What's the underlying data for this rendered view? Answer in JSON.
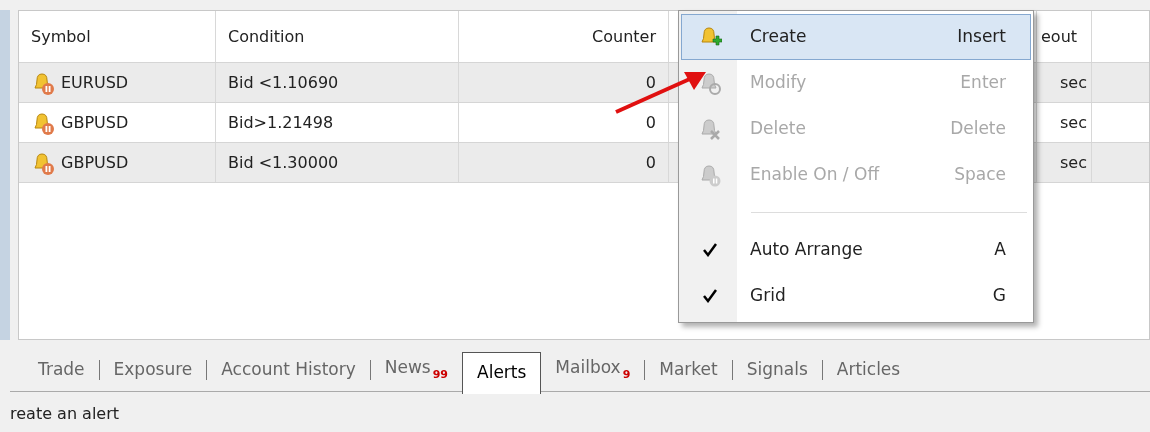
{
  "table": {
    "columns": [
      "Symbol",
      "Condition",
      "Counter",
      "",
      "eout"
    ],
    "rows": [
      {
        "symbol": "EURUSD",
        "condition": "Bid <1.10690",
        "counter": "0",
        "column_5": "sec"
      },
      {
        "symbol": "GBPUSD",
        "condition": "Bid>1.21498",
        "counter": "0",
        "column_5": "sec"
      },
      {
        "symbol": "GBPUSD",
        "condition": "Bid <1.30000",
        "counter": "0",
        "column_5": "sec"
      }
    ]
  },
  "context_menu": {
    "items": [
      {
        "kind": "command",
        "label": "Create",
        "shortcut": "Insert",
        "disabled": false,
        "selected": true
      },
      {
        "kind": "command",
        "label": "Modify",
        "shortcut": "Enter",
        "disabled": true,
        "selected": false
      },
      {
        "kind": "command",
        "label": "Delete",
        "shortcut": "Delete",
        "disabled": true,
        "selected": false
      },
      {
        "kind": "command",
        "label": "Enable On / Off",
        "shortcut": "Space",
        "disabled": true,
        "selected": false
      },
      {
        "kind": "separator"
      },
      {
        "kind": "check",
        "label": "Auto Arrange",
        "shortcut": "A",
        "checked": true,
        "selected": false
      },
      {
        "kind": "check",
        "label": "Grid",
        "shortcut": "G",
        "checked": true,
        "selected": false
      }
    ]
  },
  "tabs": [
    {
      "label": "Trade",
      "selected": false
    },
    {
      "label": "Exposure",
      "selected": false
    },
    {
      "label": "Account History",
      "selected": false
    },
    {
      "label": "News",
      "badge": "99",
      "selected": false
    },
    {
      "label": "Alerts",
      "selected": true
    },
    {
      "label": "Mailbox",
      "badge": "9",
      "selected": false
    },
    {
      "label": "Market",
      "selected": false
    },
    {
      "label": "Signals",
      "selected": false
    },
    {
      "label": "Articles",
      "selected": false
    }
  ],
  "status_bar": "reate an alert"
}
